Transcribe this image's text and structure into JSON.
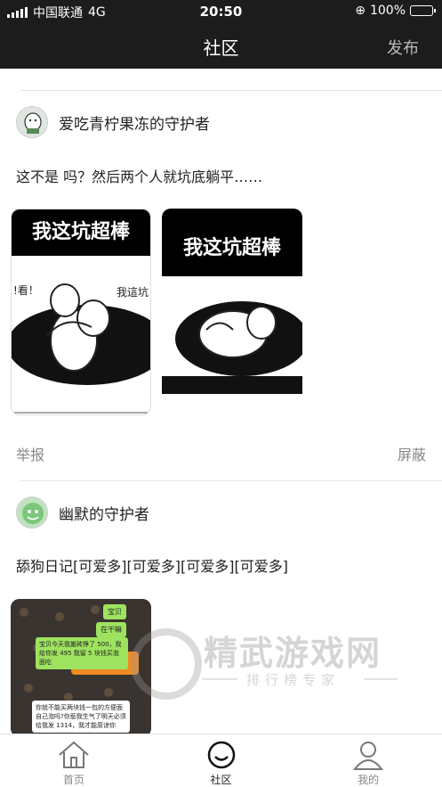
{
  "status_bar": {
    "carrier": "中国联通",
    "network": "4G",
    "time": "20:50",
    "battery": "100%",
    "battery_level": 1.0
  },
  "header": {
    "title": "社区",
    "publish_label": "发布"
  },
  "posts": [
    {
      "username": "爱吃青柠果冻的守护者",
      "text": "这不是 吗？然后两个人就坑底躺平……",
      "images": [
        {
          "caption": "我这坑超棒",
          "side_text_left": "!看！",
          "side_text_right": "我這坑"
        },
        {
          "caption": "我这坑超棒"
        }
      ],
      "report_label": "举报",
      "block_label": "屏蔽"
    },
    {
      "username": "幽默的守护者",
      "text": "舔狗日记[可爱多][可爱多][可爱多][可爱多]",
      "chat": {
        "bubble_1": "宝贝",
        "bubble_2": "在干嘛",
        "bubble_3": "宝贝今天我搬砖挣了 500，我给你发 495 我留 5 块钱买泡面吃",
        "bubble_4": "你就不能买两块钱一包的方便面自己泡吗?你惹我生气了明天必须给我发 1314，我才能原谅你"
      }
    }
  ],
  "watermark": {
    "title": "精武游戏网",
    "subtitle": "排行榜专家"
  },
  "tabbar": {
    "items": [
      {
        "label": "首页",
        "icon": "home-icon"
      },
      {
        "label": "社区",
        "icon": "smile-icon"
      },
      {
        "label": "我的",
        "icon": "user-icon"
      }
    ],
    "active": "社区"
  },
  "colors": {
    "header_bg": "#1c1c1c",
    "accent_green": "#7bc67b"
  }
}
